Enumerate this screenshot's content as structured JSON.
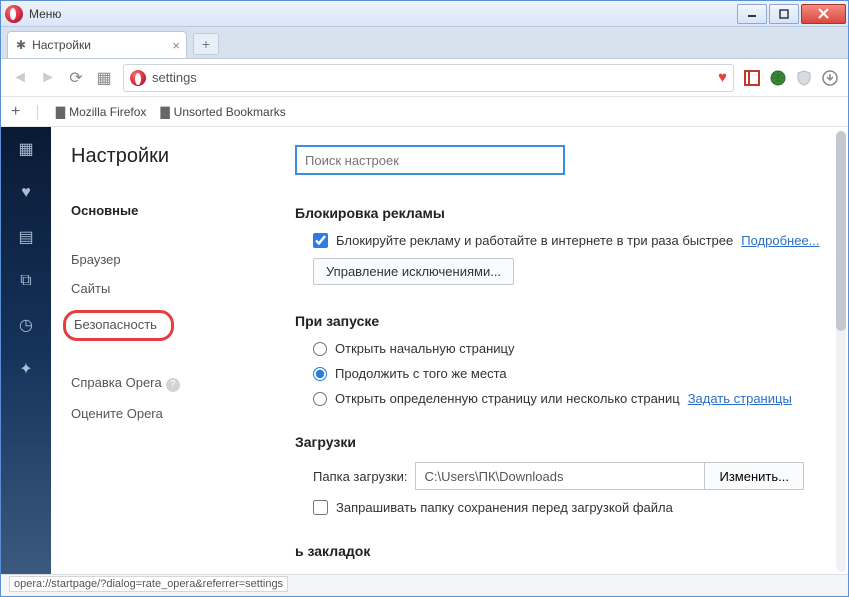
{
  "titlebar": {
    "menu": "Меню"
  },
  "tab": {
    "title": "Настройки"
  },
  "url": {
    "value": "settings"
  },
  "bookmarks": {
    "b1": "Mozilla Firefox",
    "b2": "Unsorted Bookmarks"
  },
  "nav": {
    "title": "Настройки",
    "main": "Основные",
    "browser": "Браузер",
    "sites": "Сайты",
    "security": "Безопасность",
    "help": "Справка Opera",
    "rate": "Оцените Opera"
  },
  "search": {
    "placeholder": "Поиск настроек"
  },
  "ads": {
    "heading": "Блокировка рекламы",
    "checkbox_label": "Блокируйте рекламу и работайте в интернете в три раза быстрее",
    "more": "Подробнее...",
    "exceptions": "Управление исключениями..."
  },
  "startup": {
    "heading": "При запуске",
    "opt1": "Открыть начальную страницу",
    "opt2": "Продолжить с того же места",
    "opt3": "Открыть определенную страницу или несколько страниц",
    "set_pages": "Задать страницы"
  },
  "downloads": {
    "heading": "Загрузки",
    "folder_label": "Папка загрузки:",
    "folder_value": "C:\\Users\\ПК\\Downloads",
    "change": "Изменить...",
    "ask_label": "Запрашивать папку сохранения перед загрузкой файла"
  },
  "bookmarks_bar": {
    "heading": "ь закладок"
  },
  "status": {
    "url": "opera://startpage/?dialog=rate_opera&referrer=settings"
  }
}
